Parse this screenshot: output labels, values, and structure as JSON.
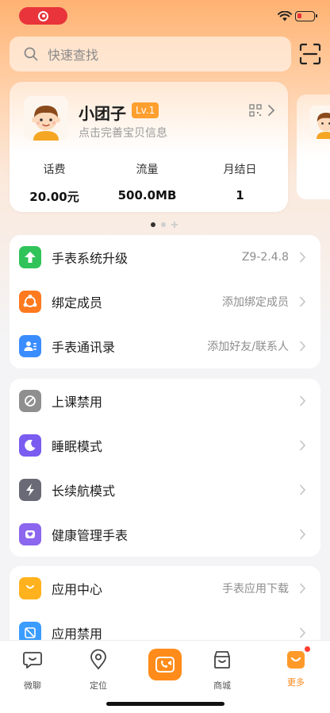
{
  "search": {
    "placeholder": "快速查找"
  },
  "profile": {
    "name": "小团子",
    "level": "Lv.1",
    "subtitle": "点击完善宝贝信息",
    "stats": [
      {
        "label": "话费",
        "value": "20.00元"
      },
      {
        "label": "流量",
        "value": "500.0MB"
      },
      {
        "label": "月结日",
        "value": "1"
      }
    ]
  },
  "group1": [
    {
      "label": "手表系统升级",
      "value": "Z9-2.4.8",
      "icon": "upgrade-icon",
      "color": "#2fc35a"
    },
    {
      "label": "绑定成员",
      "value": "添加绑定成员",
      "icon": "members-icon",
      "color": "#ff7a1f"
    },
    {
      "label": "手表通讯录",
      "value": "添加好友/联系人",
      "icon": "contacts-icon",
      "color": "#3a8dff"
    }
  ],
  "group2": [
    {
      "label": "上课禁用",
      "value": "",
      "icon": "class-disable-icon",
      "color": "#8f8f8f"
    },
    {
      "label": "睡眠模式",
      "value": "",
      "icon": "moon-icon",
      "color": "#7a5cf0"
    },
    {
      "label": "长续航模式",
      "value": "",
      "icon": "lightning-icon",
      "color": "#6a6a76"
    },
    {
      "label": "健康管理手表",
      "value": "",
      "icon": "health-watch-icon",
      "color": "#8c66ee"
    }
  ],
  "group3": [
    {
      "label": "应用中心",
      "value": "手表应用下载",
      "icon": "app-center-icon",
      "color": "#ffb21e"
    },
    {
      "label": "应用禁用",
      "value": "",
      "icon": "app-disable-icon",
      "color": "#3a9cff"
    }
  ],
  "tabs": [
    {
      "label": "微聊",
      "icon": "chat-icon"
    },
    {
      "label": "定位",
      "icon": "location-icon"
    },
    {
      "label": "",
      "icon": "video-call-icon"
    },
    {
      "label": "商城",
      "icon": "store-icon"
    },
    {
      "label": "更多",
      "icon": "more-icon"
    }
  ],
  "colors": {
    "accent": "#ff8c1a",
    "badge": "#ff3b30",
    "recording": "#e8343a"
  }
}
